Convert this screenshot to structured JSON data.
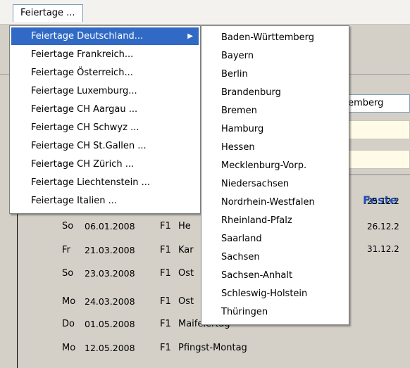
{
  "menubar": {
    "title": "Feiertage ..."
  },
  "main_menu": {
    "items": [
      {
        "label": "Feiertage Deutschland...",
        "has_submenu": true,
        "selected": true
      },
      {
        "label": "Feiertage Frankreich..."
      },
      {
        "label": "Feiertage Österreich..."
      },
      {
        "label": "Feiertage Luxemburg..."
      },
      {
        "label": "Feiertage CH Aargau ..."
      },
      {
        "label": "Feiertage CH Schwyz ..."
      },
      {
        "label": "Feiertage CH St.Gallen ..."
      },
      {
        "label": "Feiertage CH Zürich ..."
      },
      {
        "label": "Feiertage Liechtenstein ..."
      },
      {
        "label": "Feiertage Italien ..."
      }
    ],
    "submenu_arrow": "▶"
  },
  "sub_menu": {
    "items": [
      "Baden-Württemberg",
      "Bayern",
      "Berlin",
      "Brandenburg",
      "Bremen",
      "Hamburg",
      "Hessen",
      "Mecklenburg-Vorp.",
      "Niedersachsen",
      "Nordrhein-Westfalen",
      "Rheinland-Pfalz",
      "Saarland",
      "Sachsen",
      "Sachsen-Anhalt",
      "Schleswig-Holstein",
      "Thüringen"
    ]
  },
  "background": {
    "combo_value": "temberg",
    "feste_title": "Feste",
    "feste_dates": [
      "25.12.2",
      "26.12.2",
      "31.12.2"
    ],
    "holiday_rows": [
      {
        "day": "So",
        "date": "06.01.2008",
        "type": "F1",
        "name": "He"
      },
      {
        "day": "Fr",
        "date": "21.03.2008",
        "type": "F1",
        "name": "Kar"
      },
      {
        "day": "So",
        "date": "23.03.2008",
        "type": "F1",
        "name": "Ost"
      },
      {
        "day": "Mo",
        "date": "24.03.2008",
        "type": "F1",
        "name": "Ost"
      },
      {
        "day": "Do",
        "date": "01.05.2008",
        "type": "F1",
        "name": "Maifeiertag"
      },
      {
        "day": "Mo",
        "date": "12.05.2008",
        "type": "F1",
        "name": "Pfingst-Montag"
      }
    ]
  },
  "colors": {
    "highlight": "#316ac5",
    "feste_title": "#1f4fb5",
    "window_bg": "#d4d0c8"
  }
}
